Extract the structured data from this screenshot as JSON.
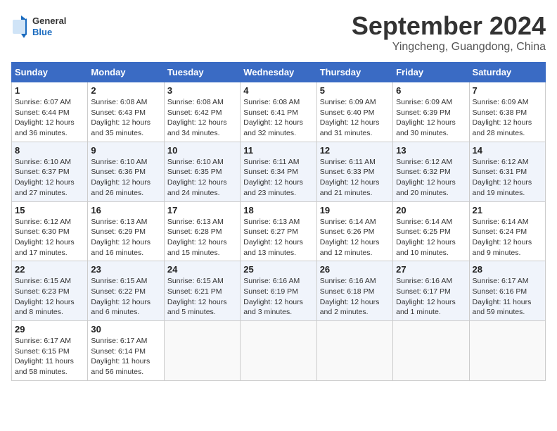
{
  "header": {
    "logo_general": "General",
    "logo_blue": "Blue",
    "month_title": "September 2024",
    "location": "Yingcheng, Guangdong, China"
  },
  "days_of_week": [
    "Sunday",
    "Monday",
    "Tuesday",
    "Wednesday",
    "Thursday",
    "Friday",
    "Saturday"
  ],
  "weeks": [
    [
      {
        "day": "1",
        "sunrise": "6:07 AM",
        "sunset": "6:44 PM",
        "daylight": "12 hours and 36 minutes."
      },
      {
        "day": "2",
        "sunrise": "6:08 AM",
        "sunset": "6:43 PM",
        "daylight": "12 hours and 35 minutes."
      },
      {
        "day": "3",
        "sunrise": "6:08 AM",
        "sunset": "6:42 PM",
        "daylight": "12 hours and 34 minutes."
      },
      {
        "day": "4",
        "sunrise": "6:08 AM",
        "sunset": "6:41 PM",
        "daylight": "12 hours and 32 minutes."
      },
      {
        "day": "5",
        "sunrise": "6:09 AM",
        "sunset": "6:40 PM",
        "daylight": "12 hours and 31 minutes."
      },
      {
        "day": "6",
        "sunrise": "6:09 AM",
        "sunset": "6:39 PM",
        "daylight": "12 hours and 30 minutes."
      },
      {
        "day": "7",
        "sunrise": "6:09 AM",
        "sunset": "6:38 PM",
        "daylight": "12 hours and 28 minutes."
      }
    ],
    [
      {
        "day": "8",
        "sunrise": "6:10 AM",
        "sunset": "6:37 PM",
        "daylight": "12 hours and 27 minutes."
      },
      {
        "day": "9",
        "sunrise": "6:10 AM",
        "sunset": "6:36 PM",
        "daylight": "12 hours and 26 minutes."
      },
      {
        "day": "10",
        "sunrise": "6:10 AM",
        "sunset": "6:35 PM",
        "daylight": "12 hours and 24 minutes."
      },
      {
        "day": "11",
        "sunrise": "6:11 AM",
        "sunset": "6:34 PM",
        "daylight": "12 hours and 23 minutes."
      },
      {
        "day": "12",
        "sunrise": "6:11 AM",
        "sunset": "6:33 PM",
        "daylight": "12 hours and 21 minutes."
      },
      {
        "day": "13",
        "sunrise": "6:12 AM",
        "sunset": "6:32 PM",
        "daylight": "12 hours and 20 minutes."
      },
      {
        "day": "14",
        "sunrise": "6:12 AM",
        "sunset": "6:31 PM",
        "daylight": "12 hours and 19 minutes."
      }
    ],
    [
      {
        "day": "15",
        "sunrise": "6:12 AM",
        "sunset": "6:30 PM",
        "daylight": "12 hours and 17 minutes."
      },
      {
        "day": "16",
        "sunrise": "6:13 AM",
        "sunset": "6:29 PM",
        "daylight": "12 hours and 16 minutes."
      },
      {
        "day": "17",
        "sunrise": "6:13 AM",
        "sunset": "6:28 PM",
        "daylight": "12 hours and 15 minutes."
      },
      {
        "day": "18",
        "sunrise": "6:13 AM",
        "sunset": "6:27 PM",
        "daylight": "12 hours and 13 minutes."
      },
      {
        "day": "19",
        "sunrise": "6:14 AM",
        "sunset": "6:26 PM",
        "daylight": "12 hours and 12 minutes."
      },
      {
        "day": "20",
        "sunrise": "6:14 AM",
        "sunset": "6:25 PM",
        "daylight": "12 hours and 10 minutes."
      },
      {
        "day": "21",
        "sunrise": "6:14 AM",
        "sunset": "6:24 PM",
        "daylight": "12 hours and 9 minutes."
      }
    ],
    [
      {
        "day": "22",
        "sunrise": "6:15 AM",
        "sunset": "6:23 PM",
        "daylight": "12 hours and 8 minutes."
      },
      {
        "day": "23",
        "sunrise": "6:15 AM",
        "sunset": "6:22 PM",
        "daylight": "12 hours and 6 minutes."
      },
      {
        "day": "24",
        "sunrise": "6:15 AM",
        "sunset": "6:21 PM",
        "daylight": "12 hours and 5 minutes."
      },
      {
        "day": "25",
        "sunrise": "6:16 AM",
        "sunset": "6:19 PM",
        "daylight": "12 hours and 3 minutes."
      },
      {
        "day": "26",
        "sunrise": "6:16 AM",
        "sunset": "6:18 PM",
        "daylight": "12 hours and 2 minutes."
      },
      {
        "day": "27",
        "sunrise": "6:16 AM",
        "sunset": "6:17 PM",
        "daylight": "12 hours and 1 minute."
      },
      {
        "day": "28",
        "sunrise": "6:17 AM",
        "sunset": "6:16 PM",
        "daylight": "11 hours and 59 minutes."
      }
    ],
    [
      {
        "day": "29",
        "sunrise": "6:17 AM",
        "sunset": "6:15 PM",
        "daylight": "11 hours and 58 minutes."
      },
      {
        "day": "30",
        "sunrise": "6:17 AM",
        "sunset": "6:14 PM",
        "daylight": "11 hours and 56 minutes."
      },
      null,
      null,
      null,
      null,
      null
    ]
  ]
}
